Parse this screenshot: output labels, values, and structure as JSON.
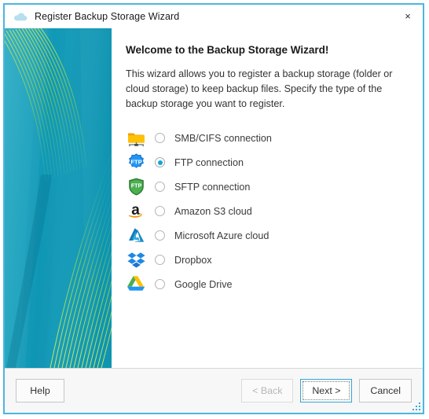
{
  "window": {
    "title": "Register Backup Storage Wizard",
    "title_icon": "cloud-icon",
    "close_label": "×",
    "accent_color": "#4bb7de"
  },
  "banner": {
    "base_color": "#0a96b5",
    "line_color": "#a8dd3a"
  },
  "content": {
    "headline": "Welcome to the Backup Storage Wizard!",
    "description": "This wizard allows you to register a backup storage (folder or cloud storage) to keep backup files. Specify the type of the backup storage you want to register."
  },
  "options": [
    {
      "id": "smb",
      "label": "SMB/CIFS connection",
      "icon": "network-folder-icon",
      "selected": false
    },
    {
      "id": "ftp",
      "label": "FTP connection",
      "icon": "ftp-badge-icon",
      "selected": true
    },
    {
      "id": "sftp",
      "label": "SFTP connection",
      "icon": "sftp-shield-icon",
      "selected": false
    },
    {
      "id": "amazon",
      "label": "Amazon S3 cloud",
      "icon": "amazon-s3-icon",
      "selected": false
    },
    {
      "id": "azure",
      "label": "Microsoft Azure cloud",
      "icon": "microsoft-azure-icon",
      "selected": false
    },
    {
      "id": "dropbox",
      "label": "Dropbox",
      "icon": "dropbox-icon",
      "selected": false
    },
    {
      "id": "gdrive",
      "label": "Google Drive",
      "icon": "google-drive-icon",
      "selected": false
    }
  ],
  "footer": {
    "help_label": "Help",
    "back_label": "< Back",
    "next_label": "Next >",
    "cancel_label": "Cancel",
    "back_disabled": true,
    "next_is_default": true
  }
}
